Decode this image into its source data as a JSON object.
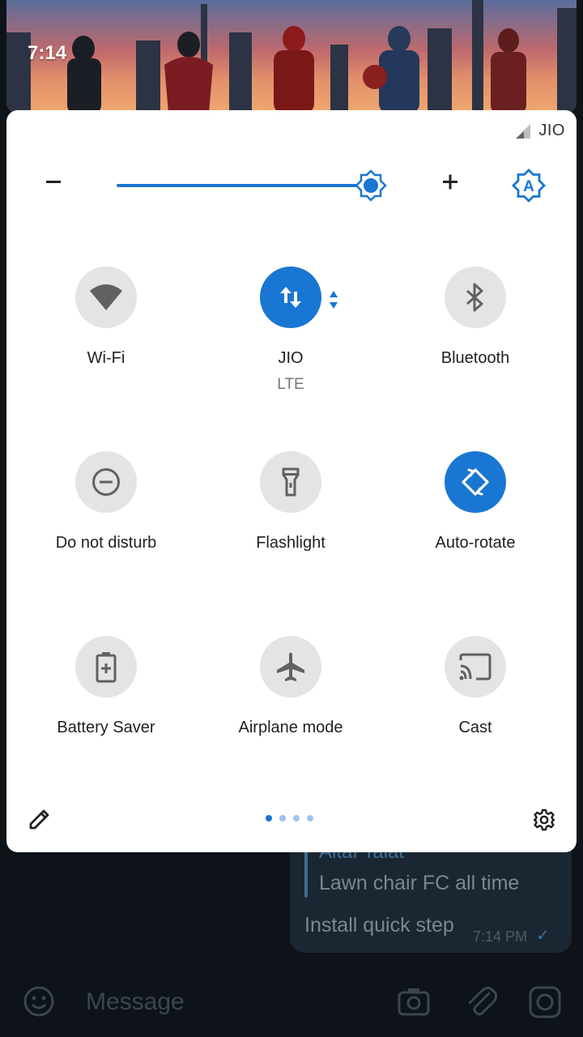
{
  "status_bar": {
    "time": "7:14"
  },
  "quick_settings": {
    "carrier": "JIO",
    "brightness": {
      "level": 0.96,
      "auto": true
    },
    "tiles": [
      {
        "id": "wifi",
        "label": "Wi-Fi",
        "sublabel": "",
        "icon": "wifi-icon",
        "active": false
      },
      {
        "id": "mobile-data",
        "label": "JIO",
        "sublabel": "LTE",
        "icon": "mobile-data-icon",
        "active": true
      },
      {
        "id": "bluetooth",
        "label": "Bluetooth",
        "sublabel": "",
        "icon": "bluetooth-icon",
        "active": false
      },
      {
        "id": "dnd",
        "label": "Do not disturb",
        "sublabel": "",
        "icon": "do-not-disturb-icon",
        "active": false
      },
      {
        "id": "flashlight",
        "label": "Flashlight",
        "sublabel": "",
        "icon": "flashlight-icon",
        "active": false
      },
      {
        "id": "auto-rotate",
        "label": "Auto-rotate",
        "sublabel": "",
        "icon": "auto-rotate-icon",
        "active": true
      },
      {
        "id": "battery-saver",
        "label": "Battery Saver",
        "sublabel": "",
        "icon": "battery-saver-icon",
        "active": false
      },
      {
        "id": "airplane",
        "label": "Airplane mode",
        "sublabel": "",
        "icon": "airplane-icon",
        "active": false
      },
      {
        "id": "cast",
        "label": "Cast",
        "sublabel": "",
        "icon": "cast-icon",
        "active": false
      }
    ],
    "page_indicator": {
      "current": 1,
      "total": 4
    }
  },
  "chat": {
    "reply_name": "Altaf Talat",
    "reply_text": "Lawn chair FC all time",
    "message_text": "Install quick step",
    "message_time": "7:14 PM",
    "input_placeholder": "Message"
  },
  "colors": {
    "accent": "#1976d2",
    "tile_inactive": "#e4e4e4",
    "panel": "#ffffff"
  }
}
